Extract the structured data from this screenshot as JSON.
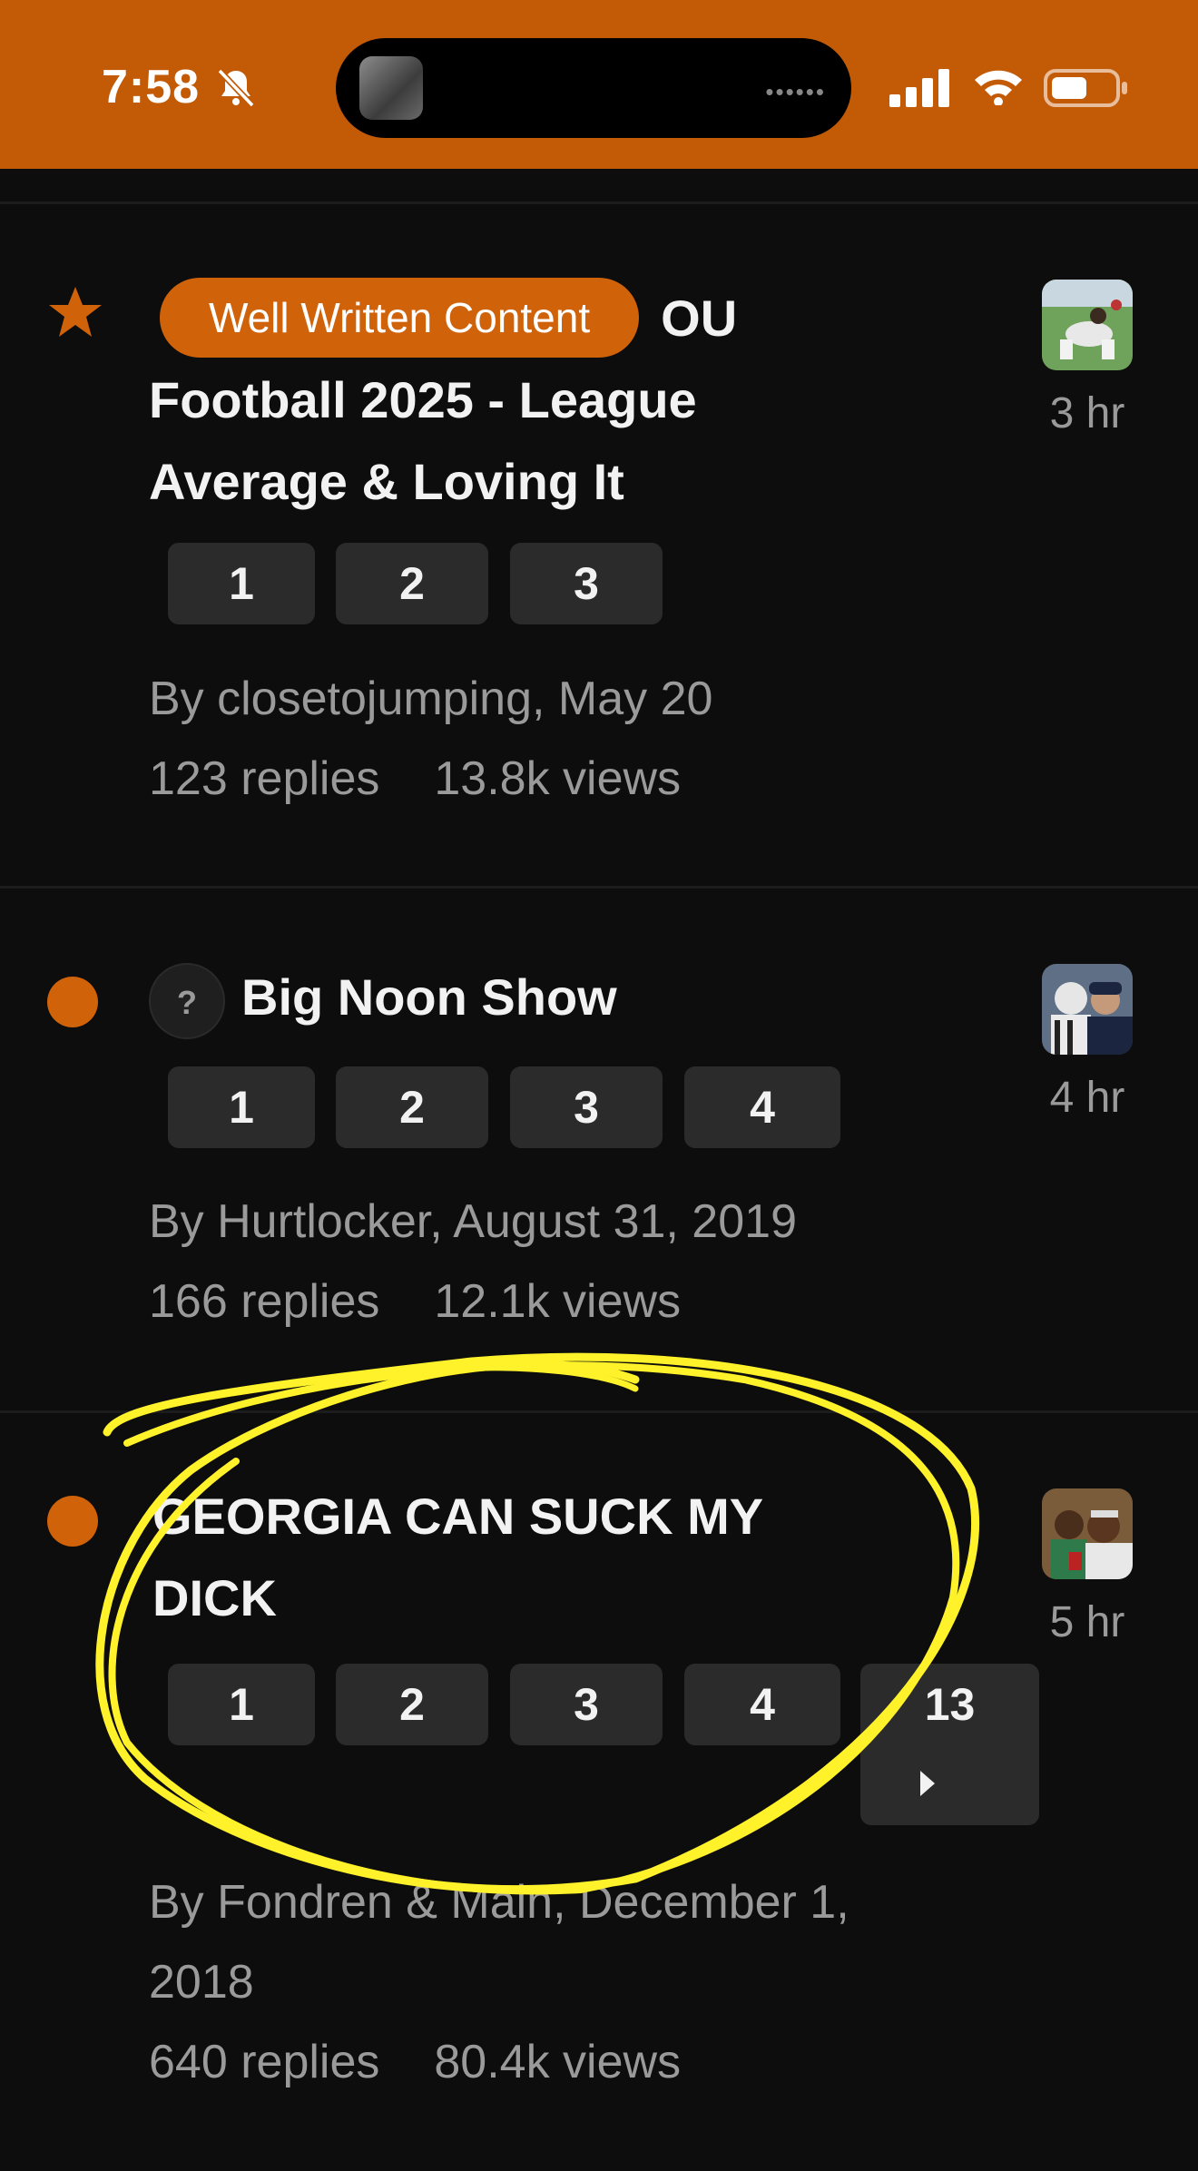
{
  "status_bar": {
    "time": "7:58",
    "icons": [
      "bell-slash-icon",
      "cellular-signal-icon",
      "wifi-icon",
      "battery-icon"
    ],
    "accent": "#c35a06"
  },
  "topics": [
    {
      "marker": "star-icon",
      "badge": "Well Written Content",
      "title": "OU Football 2025 - League Average & Loving It",
      "pages": [
        "1",
        "2",
        "3"
      ],
      "byline": "By closetojumping, May 20",
      "replies": "123 replies",
      "views": "13.8k views",
      "age": "3 hr"
    },
    {
      "marker": "unread-dot",
      "prefix_icon": "question-icon",
      "prefix_text": "?",
      "title": "Big Noon Show",
      "pages": [
        "1",
        "2",
        "3",
        "4"
      ],
      "byline": "By Hurtlocker, August 31, 2019",
      "replies": "166 replies",
      "views": "12.1k views",
      "age": "4 hr"
    },
    {
      "marker": "unread-dot",
      "title": "GEORGIA CAN SUCK MY DICK",
      "pages": [
        "1",
        "2",
        "3",
        "4",
        "13"
      ],
      "byline": "By Fondren & Main, December 1, 2018",
      "replies": "640 replies",
      "views": "80.4k views",
      "age": "5 hr"
    }
  ],
  "colors": {
    "background": "#0d0d0d",
    "accent": "#d0620a",
    "annotation": "#fff22a"
  }
}
